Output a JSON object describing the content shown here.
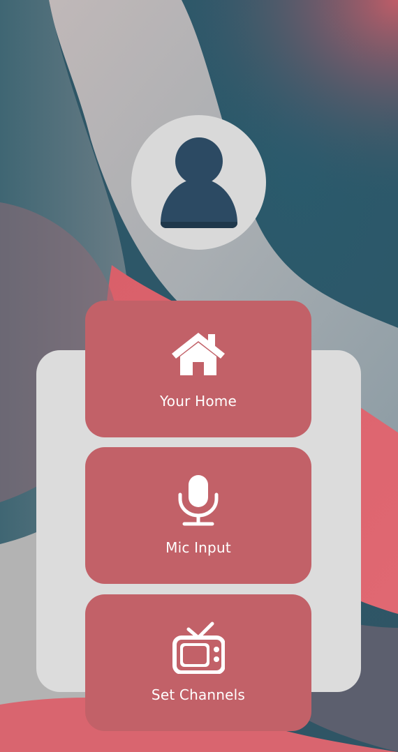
{
  "profile": {
    "avatar_icon": "person-icon"
  },
  "menu": {
    "items": [
      {
        "label": "Your Home",
        "icon": "home-icon"
      },
      {
        "label": "Mic Input",
        "icon": "microphone-icon"
      },
      {
        "label": "Set Channels",
        "icon": "tv-icon"
      }
    ]
  },
  "colors": {
    "tile": "#c26168",
    "panel": "#dcdcdc",
    "avatar_bg": "#d9d9d9",
    "avatar_fg": "#2c4a63",
    "text": "#ffffff"
  }
}
